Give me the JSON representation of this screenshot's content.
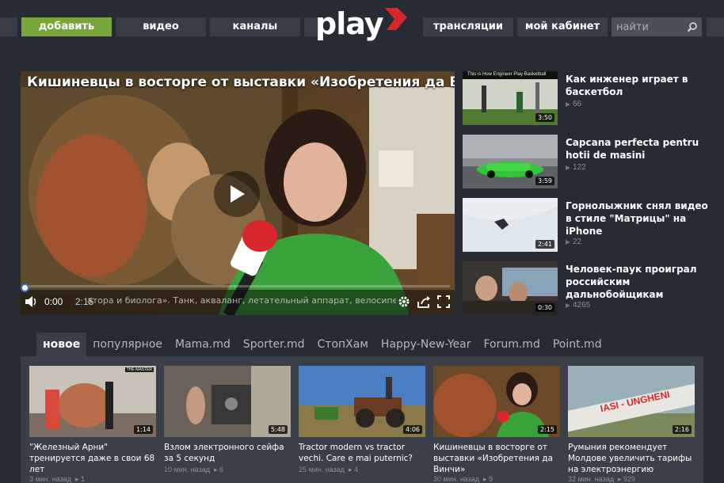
{
  "nav": {
    "add": "добавить",
    "video": "видео",
    "channels": "каналы",
    "broadcasts": "трансляции",
    "cabinet": "мой кабинет",
    "search_placeholder": "найти",
    "logo_text": "play"
  },
  "player": {
    "title": "Кишиневцы в восторге от выставки «Изобретения да Винчи»",
    "current_time": "0:00",
    "duration": "2:15",
    "progress": 0,
    "caption": "атора и биолога». Танк, акваланг, летательный аппарат, велосипед, парашют, подводная лодка"
  },
  "side": [
    {
      "title": "Как инженер играет в баскетбол",
      "views": "66",
      "duration": "3:50",
      "thumb_caption": "This is How Engineer Play Basketball"
    },
    {
      "title": "Capcana perfecta pentru hotii de masini",
      "views": "122",
      "duration": "3:59"
    },
    {
      "title": "Горнолыжник снял видео в стиле \"Матрицы\" на iPhone",
      "views": "22",
      "duration": "2:41"
    },
    {
      "title": "Человек-паук проиграл российским дальнобойщикам",
      "views": "4265",
      "duration": "0:30"
    }
  ],
  "tabs": [
    "новое",
    "популярное",
    "Mama.md",
    "Sporter.md",
    "СтопХам",
    "Happy-New-Year",
    "Forum.md",
    "Point.md"
  ],
  "cards": [
    {
      "title": "\"Железный Арни\" тренируется даже в свои 68 лет",
      "time": "3 мин. назад",
      "views": "1",
      "duration": "1:14",
      "badge": "THE MASTER"
    },
    {
      "title": "Взлом электронного сейфа за 5 секунд",
      "time": "10 мин. назад",
      "views": "6",
      "duration": "5:48"
    },
    {
      "title": "Tractor modern vs tractor vechi. Care e mai puternic?",
      "time": "25 мин. назад",
      "views": "4",
      "duration": "4:06"
    },
    {
      "title": "Кишиневцы в восторге от выставки «Изобретения да Винчи»",
      "time": "30 мин. назад",
      "views": "9",
      "duration": "2:15"
    },
    {
      "title": "Румыния рекомендует Молдове увеличить тарифы на электроэнергию",
      "time": "32 мин. назад",
      "views": "929",
      "duration": "2:16",
      "pipe_text": "IASI - UNGHENI"
    }
  ],
  "colors": {
    "accent_green": "#79a63a",
    "logo_red": "#d8262d",
    "bg": "#272b34"
  }
}
